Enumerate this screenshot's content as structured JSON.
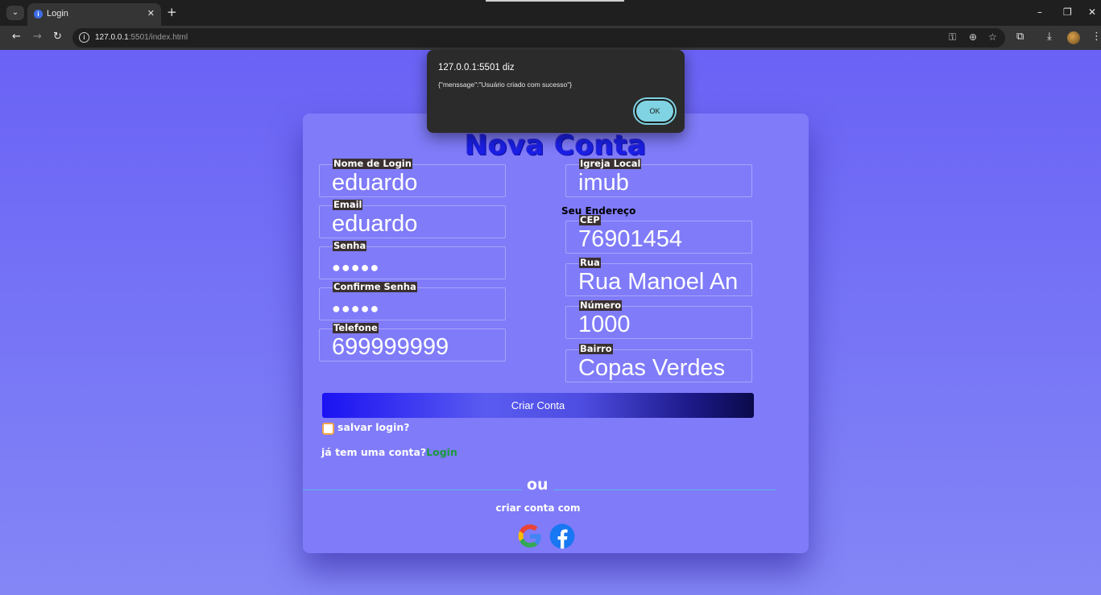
{
  "browser": {
    "tab_title": "Login",
    "url_host": "127.0.0.1",
    "url_rest": ":5501/index.html"
  },
  "icons": {
    "tab_menu": "chevron-down-icon",
    "favicon": "info-icon",
    "close": "close-icon",
    "new_tab": "plus-icon",
    "back": "arrow-left-icon",
    "forward": "arrow-right-icon",
    "reload": "reload-icon",
    "site_info": "info-icon",
    "password": "key-icon",
    "zoom": "zoom-icon",
    "bookmark": "star-icon",
    "extensions": "puzzle-icon",
    "download": "download-icon",
    "menu": "kebab-menu-icon",
    "google": "google-icon",
    "facebook": "facebook-icon"
  },
  "dialog": {
    "title": "127.0.0.1:5501 diz",
    "message": "{\"menssage\":\"Usuário criado com sucesso\"}",
    "ok_label": "OK"
  },
  "form": {
    "title": "Nova Conta",
    "login": {
      "label": "Nome de Login",
      "value": "eduardo"
    },
    "email": {
      "label": "Email",
      "value": "eduardo"
    },
    "senha": {
      "label": "Senha",
      "value": "●●●●●"
    },
    "confirme_senha": {
      "label": "Confirme Senha",
      "value": "●●●●●"
    },
    "telefone": {
      "label": "Telefone",
      "value": "699999999"
    },
    "igreja": {
      "label": "Igreja Local",
      "value": "imub"
    },
    "address_heading": "Seu Endereço",
    "cep": {
      "label": "CEP",
      "value": "76901454"
    },
    "rua": {
      "label": "Rua",
      "value": "Rua Manoel An"
    },
    "numero": {
      "label": "Número",
      "value": "1000"
    },
    "bairro": {
      "label": "Bairro",
      "value": "Copas Verdes"
    },
    "submit_label": "Criar Conta",
    "remember_label": "salvar login?",
    "have_account_text": "já tem uma conta?",
    "login_link": "Login",
    "or_text": "ou",
    "create_with_text": "criar conta com"
  },
  "colors": {
    "background": "#6a62f5",
    "card": "#7f7bf9",
    "title": "#1a1fe6",
    "label_bg": "#3a3030",
    "link": "#1a9a3a",
    "ok_button": "#7fd3e2"
  }
}
